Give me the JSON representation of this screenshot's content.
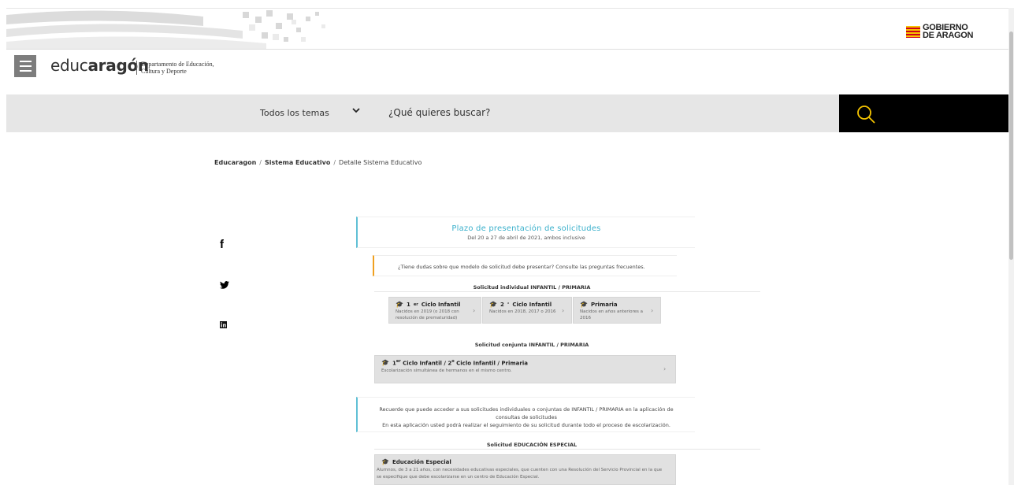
{
  "header": {
    "gov_logo_line1": "GOBIERNO",
    "gov_logo_line2": "DE ARAGON",
    "brand_regular": "educ",
    "brand_bold": "aragón",
    "dept_line1": "Departamento de Educación,",
    "dept_line2": "Cultura y Deporte"
  },
  "search": {
    "topics_label": "Todos los temas",
    "placeholder": "¿Qué quieres buscar?"
  },
  "breadcrumb": {
    "item1": "Educaragon",
    "item2": "Sistema Educativo",
    "current": "Detalle Sistema Educativo",
    "separator": "/"
  },
  "social": {
    "facebook": "f",
    "icons": [
      "facebook-icon",
      "twitter-icon",
      "linkedin-icon"
    ]
  },
  "plazo": {
    "title": "Plazo de presentación de solicitudes",
    "subtitle": "Del 20 a 27 de abril de 2021, ambos inclusive"
  },
  "doubt_text": "¿Tiene dudas sobre que modelo de solicitud debe presentar? Consulte las preguntas frecuentes.",
  "individual": {
    "title": "Solicitud individual INFANTIL / PRIMARIA",
    "cards": [
      {
        "prefix": "1",
        "sup": "er",
        "title": "Ciclo Infantil",
        "desc1": "Nacidos en 2019 (o 2018 con",
        "desc2": "resolución de prematuridad)"
      },
      {
        "prefix": "2",
        "sup": "°",
        "title": "Ciclo Infantil",
        "desc1": "Nacidos en 2018, 2017 o 2016",
        "desc2": ""
      },
      {
        "prefix": "",
        "sup": "",
        "title": "Primaria",
        "desc1": "Nacidos en años anteriores a",
        "desc2": "2016"
      }
    ]
  },
  "joint": {
    "title": "Solicitud conjunta INFANTIL / PRIMARIA",
    "card_title_a": "1",
    "card_sup_a": "er",
    "card_title_b": " Ciclo Infantil / 2",
    "card_sup_b": "o",
    "card_title_c": " Ciclo Infantil / Primaria",
    "card_desc": "Escolarización simultánea de hermanos en el mismo centro."
  },
  "remind": {
    "line1": "Recuerde que puede acceder a sus solicitudes individuales o conjuntas de INFANTIL / PRIMARIA en la aplicación de",
    "line2": "consultas de solicitudes",
    "line3": "En esta aplicación usted podrá realizar el seguimiento de su solicitud durante todo el proceso de escolarización."
  },
  "special": {
    "title": "Solicitud EDUCACIÓN ESPECIAL",
    "card_title": "Educación Especial",
    "card_desc1": "Alumnos, de 3 a 21 años, con necesidades educativas especiales, que cuenten con una Resolución del Servicio Provincial en la que",
    "card_desc2": "se especifique que debe escolarizarse en un centro de Educación Especial."
  },
  "colors": {
    "accent_blue": "#3cb1cc",
    "accent_orange": "#f0a020",
    "search_icon": "#f5c400"
  }
}
